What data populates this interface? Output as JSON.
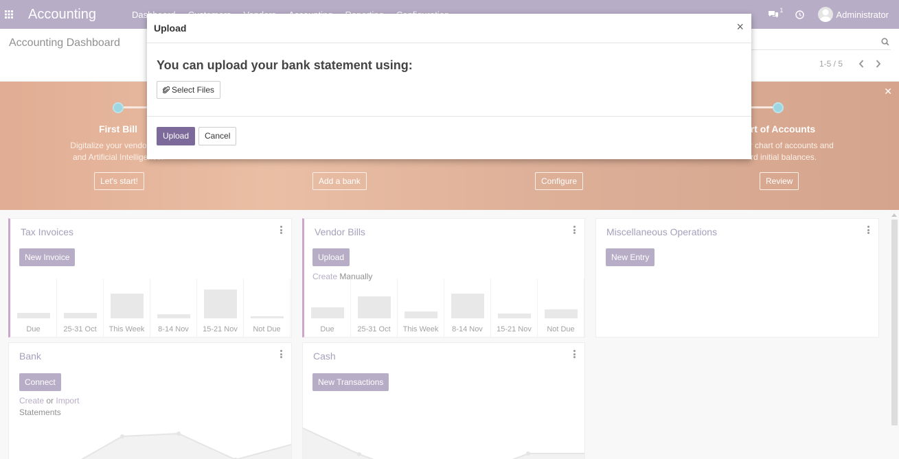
{
  "navbar": {
    "brand": "Accounting",
    "menu": [
      "Dashboard",
      "Customers",
      "Vendors",
      "Accounting",
      "Reporting",
      "Configuration"
    ],
    "chat_count": "1",
    "user": "Administrator"
  },
  "control_panel": {
    "title": "Accounting Dashboard",
    "pager": "1-5 / 5"
  },
  "banner": {
    "steps": [
      {
        "title": "First Bill",
        "desc_line1": "Digitalize your vendor bills",
        "desc_line2": "and Artificial Intelligence.",
        "button": "Let's start!"
      },
      {
        "title": "",
        "desc_line1": "",
        "desc_line2": "",
        "button": "Add a bank"
      },
      {
        "title": "",
        "desc_line1": "",
        "desc_line2": "",
        "button": "Configure"
      },
      {
        "title": "art of Accounts",
        "desc_line1": "ur chart of accounts and",
        "desc_line2": "rd initial balances.",
        "button": "Review"
      }
    ]
  },
  "cards": {
    "tax_invoices": {
      "title": "Tax Invoices",
      "button": "New Invoice",
      "bars": [
        {
          "label": "Due",
          "value": 8
        },
        {
          "label": "25-31 Oct",
          "value": 8
        },
        {
          "label": "This Week",
          "value": 36
        },
        {
          "label": "8-14 Nov",
          "value": 6
        },
        {
          "label": "15-21 Nov",
          "value": 42
        },
        {
          "label": "Not Due",
          "value": 3
        }
      ]
    },
    "vendor_bills": {
      "title": "Vendor Bills",
      "button": "Upload",
      "create_link": "Create",
      "create_suffix": "Manually",
      "bars": [
        {
          "label": "Due",
          "value": 16
        },
        {
          "label": "25-31 Oct",
          "value": 32
        },
        {
          "label": "This Week",
          "value": 10
        },
        {
          "label": "8-14 Nov",
          "value": 36
        },
        {
          "label": "15-21 Nov",
          "value": 7
        },
        {
          "label": "Not Due",
          "value": 13
        }
      ]
    },
    "misc_operations": {
      "title": "Miscellaneous Operations",
      "button": "New Entry"
    },
    "bank": {
      "title": "Bank",
      "button": "Connect",
      "create_link": "Create",
      "or_text": "or",
      "import_link": "Import",
      "statements": "Statements"
    },
    "cash": {
      "title": "Cash",
      "button": "New Transactions"
    }
  },
  "modal": {
    "title": "Upload",
    "close": "×",
    "heading": "You can upload your bank statement using:",
    "select_files": "Select Files",
    "upload_button": "Upload",
    "cancel_button": "Cancel"
  },
  "colors": {
    "brand": "#7c6a9a",
    "banner": "#c86a3c",
    "accent_border": "#a35ba3"
  }
}
